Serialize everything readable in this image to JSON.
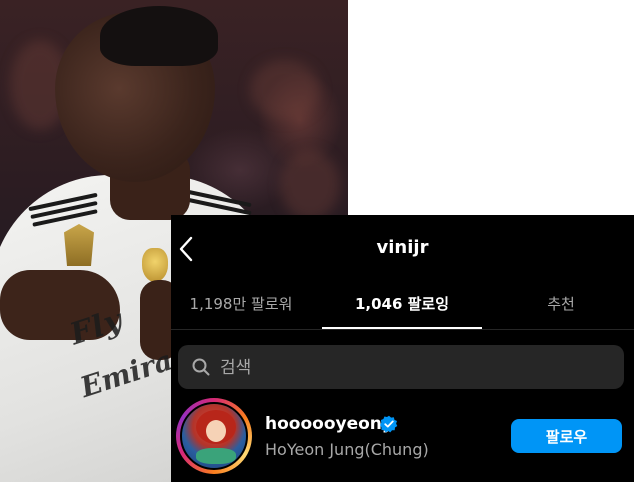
{
  "profile": {
    "username": "vinijr"
  },
  "tabs": [
    {
      "label": "1,198만 팔로워",
      "active": false
    },
    {
      "label": "1,046 팔로잉",
      "active": true
    },
    {
      "label": "추천",
      "active": false
    }
  ],
  "search": {
    "placeholder": "검색",
    "icon": "search-icon"
  },
  "following_list": [
    {
      "username": "hoooooyeony",
      "full_name": "HoYeon Jung(Chung)",
      "verified": true,
      "button_label": "팔로우"
    }
  ],
  "colors": {
    "background": "#000000",
    "follow_button": "#0095f6",
    "verified_badge": "#0095f6",
    "search_bg": "#262626",
    "secondary_text": "#a8a8a8"
  },
  "photo": {
    "sponsor_text_1": "Fly",
    "sponsor_text_2": "Emirates"
  }
}
